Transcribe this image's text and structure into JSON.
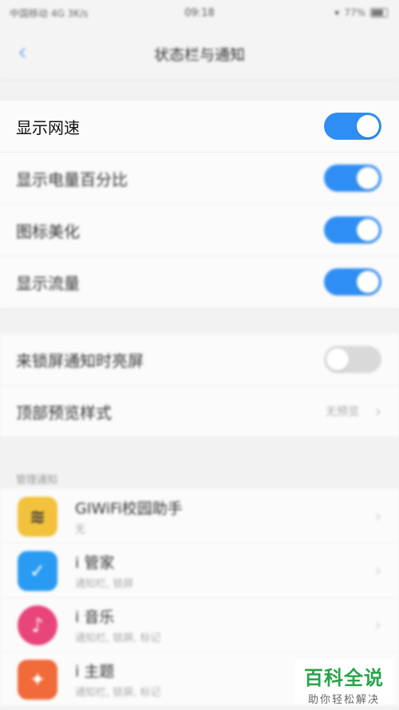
{
  "status_bar": {
    "left": "中国移动 4G 3K/s",
    "time": "09:18",
    "battery": "77%"
  },
  "nav": {
    "title": "状态栏与通知",
    "back_icon": "chevron-left-icon"
  },
  "section1": {
    "rows": [
      {
        "label": "显示网速",
        "toggle": "on"
      },
      {
        "label": "显示电量百分比",
        "toggle": "on"
      },
      {
        "label": "图标美化",
        "toggle": "on"
      },
      {
        "label": "显示流量",
        "toggle": "on"
      }
    ]
  },
  "section2": {
    "rows": [
      {
        "label": "来锁屏通知时亮屏",
        "toggle": "off"
      },
      {
        "label": "顶部预览样式",
        "value": "无预览"
      }
    ]
  },
  "apps": {
    "header": "管理通知",
    "items": [
      {
        "name": "GIWiFi校园助手",
        "sub": "无",
        "icon": "wifi-app-icon",
        "color": "#f2c23c"
      },
      {
        "name": "i 管家",
        "sub": "通知栏, 锁屏",
        "icon": "shield-app-icon",
        "color": "#2a9bf2"
      },
      {
        "name": "i 音乐",
        "sub": "通知栏, 锁屏, 标记",
        "icon": "music-app-icon",
        "color": "#e8457a"
      },
      {
        "name": "i 主题",
        "sub": "通知栏, 锁屏, 标记",
        "icon": "theme-app-icon",
        "color": "#f06a3a"
      }
    ]
  },
  "watermark": {
    "title": "百科全说",
    "subtitle": "助你轻松解决"
  },
  "colors": {
    "accent": "#2f8ef4",
    "toggle_off": "#d9d9d9"
  }
}
